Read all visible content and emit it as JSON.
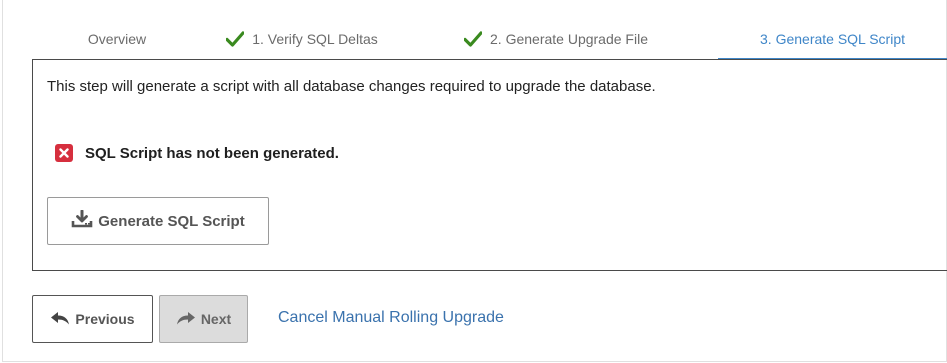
{
  "tabs": [
    {
      "label": "Overview",
      "completed": false,
      "active": false
    },
    {
      "label": "1. Verify SQL Deltas",
      "completed": true,
      "active": false
    },
    {
      "label": "2. Generate Upgrade File",
      "completed": true,
      "active": false
    },
    {
      "label": "3. Generate SQL Script",
      "completed": false,
      "active": true
    }
  ],
  "panel": {
    "description": "This step will generate a script with all database changes required to upgrade the database.",
    "status_text": "SQL Script has not been generated.",
    "status_icon": "error-x-icon",
    "generate_button_label": "Generate SQL Script"
  },
  "footer": {
    "previous_label": "Previous",
    "next_label": "Next",
    "cancel_link": "Cancel Manual Rolling Upgrade"
  },
  "colors": {
    "accent": "#3f86c8",
    "check_green": "#3a8a1f",
    "error_red": "#d62f3e",
    "link": "#3a72ad"
  }
}
